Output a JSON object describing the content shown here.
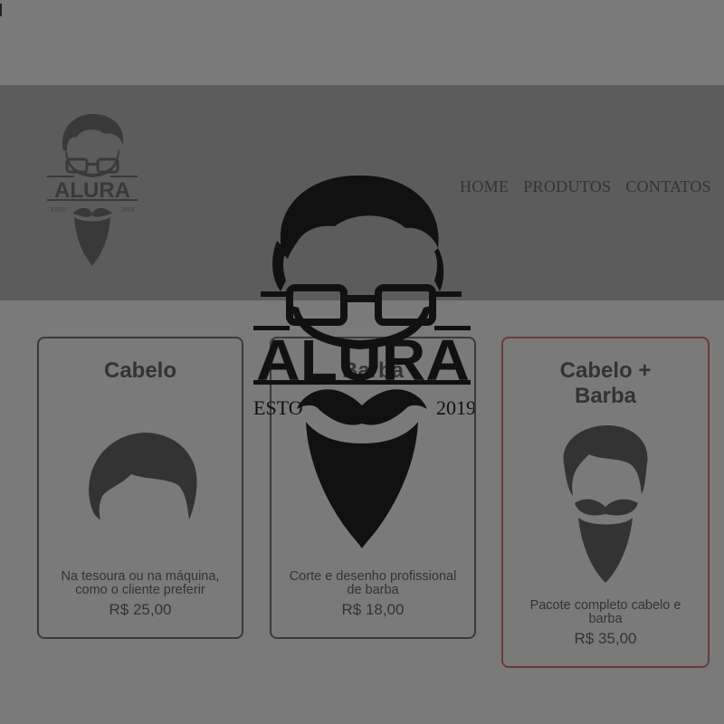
{
  "brand": {
    "name": "ALURA",
    "established": "ESTO",
    "year": "2019"
  },
  "nav": {
    "items": [
      "HOME",
      "PRODUTOS",
      "CONTATOS"
    ]
  },
  "products": [
    {
      "title": "Cabelo",
      "description": "Na tesoura ou na máquina, como o cliente preferir",
      "price": "R$ 25,00",
      "icon": "hair-icon"
    },
    {
      "title": "Barba",
      "description": "Corte e desenho profissional de barba",
      "price": "R$ 18,00",
      "icon": "beard-icon"
    },
    {
      "title": "Cabelo + Barba",
      "description": "Pacote completo cabelo e barba",
      "price": "R$ 35,00",
      "icon": "hair-and-beard-icon"
    }
  ],
  "colors": {
    "background": "#7a7a7a",
    "header": "#5c5c5c",
    "text": "#333333",
    "highlight_border": "#6b3b3b"
  }
}
